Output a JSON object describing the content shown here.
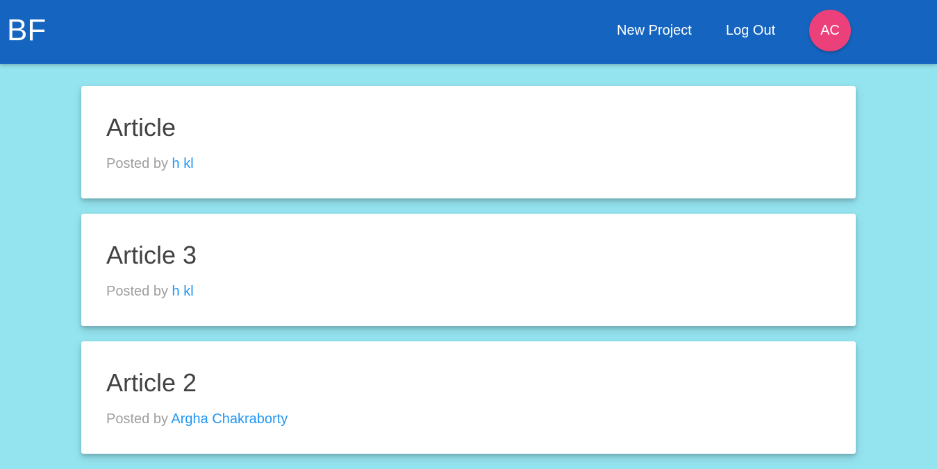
{
  "navbar": {
    "brand": "BF",
    "links": [
      {
        "label": "New Project"
      },
      {
        "label": "Log Out"
      }
    ],
    "avatar_initials": "AC",
    "colors": {
      "bar": "#1565c0",
      "avatar": "#ec407a"
    }
  },
  "articles": [
    {
      "title": "Article",
      "posted_by_label": "Posted by",
      "author": "h kl"
    },
    {
      "title": "Article 3",
      "posted_by_label": "Posted by",
      "author": "h kl"
    },
    {
      "title": "Article 2",
      "posted_by_label": "Posted by",
      "author": "Argha Chakraborty"
    }
  ],
  "colors": {
    "page_background": "#94e4f0",
    "author_link": "#2196f3"
  }
}
